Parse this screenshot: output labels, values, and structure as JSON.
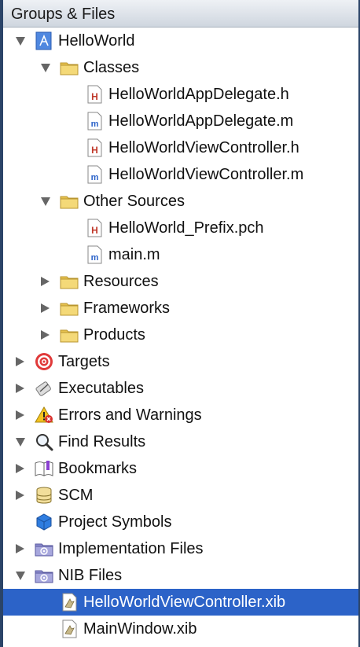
{
  "header": {
    "title": "Groups & Files"
  },
  "tree": [
    {
      "label": "HelloWorld",
      "icon": "xcode-project-icon",
      "indent": 0,
      "expander": "down"
    },
    {
      "label": "Classes",
      "icon": "folder-icon",
      "indent": 1,
      "expander": "down"
    },
    {
      "label": "HelloWorldAppDelegate.h",
      "icon": "header-file-icon",
      "indent": 2,
      "expander": "none"
    },
    {
      "label": "HelloWorldAppDelegate.m",
      "icon": "source-file-icon",
      "indent": 2,
      "expander": "none"
    },
    {
      "label": "HelloWorldViewController.h",
      "icon": "header-file-icon",
      "indent": 2,
      "expander": "none"
    },
    {
      "label": "HelloWorldViewController.m",
      "icon": "source-file-icon",
      "indent": 2,
      "expander": "none"
    },
    {
      "label": "Other Sources",
      "icon": "folder-icon",
      "indent": 1,
      "expander": "down"
    },
    {
      "label": "HelloWorld_Prefix.pch",
      "icon": "header-file-icon",
      "indent": 2,
      "expander": "none"
    },
    {
      "label": "main.m",
      "icon": "source-file-icon",
      "indent": 2,
      "expander": "none"
    },
    {
      "label": "Resources",
      "icon": "folder-icon",
      "indent": 1,
      "expander": "right"
    },
    {
      "label": "Frameworks",
      "icon": "folder-icon",
      "indent": 1,
      "expander": "right"
    },
    {
      "label": "Products",
      "icon": "folder-icon",
      "indent": 1,
      "expander": "right"
    },
    {
      "label": "Targets",
      "icon": "target-icon",
      "indent": 0,
      "expander": "right"
    },
    {
      "label": "Executables",
      "icon": "executable-icon",
      "indent": 0,
      "expander": "right"
    },
    {
      "label": "Errors and Warnings",
      "icon": "warning-icon",
      "indent": 0,
      "expander": "right"
    },
    {
      "label": "Find Results",
      "icon": "magnifier-icon",
      "indent": 0,
      "expander": "down"
    },
    {
      "label": "Bookmarks",
      "icon": "bookmarks-icon",
      "indent": 0,
      "expander": "right"
    },
    {
      "label": "SCM",
      "icon": "scm-icon",
      "indent": 0,
      "expander": "right"
    },
    {
      "label": "Project Symbols",
      "icon": "project-symbols-icon",
      "indent": 0,
      "expander": "none"
    },
    {
      "label": "Implementation Files",
      "icon": "smart-group-icon",
      "indent": 0,
      "expander": "right"
    },
    {
      "label": "NIB Files",
      "icon": "smart-group-icon",
      "indent": 0,
      "expander": "down"
    },
    {
      "label": "HelloWorldViewController.xib",
      "icon": "xib-file-icon",
      "indent": 1,
      "expander": "none",
      "selected": true
    },
    {
      "label": "MainWindow.xib",
      "icon": "xib-file-icon",
      "indent": 1,
      "expander": "none"
    }
  ],
  "colors": {
    "selection": "#2c63c8",
    "folder": "#f2d46c",
    "header_badge": "#c0392b",
    "source_badge": "#2a62c9"
  }
}
